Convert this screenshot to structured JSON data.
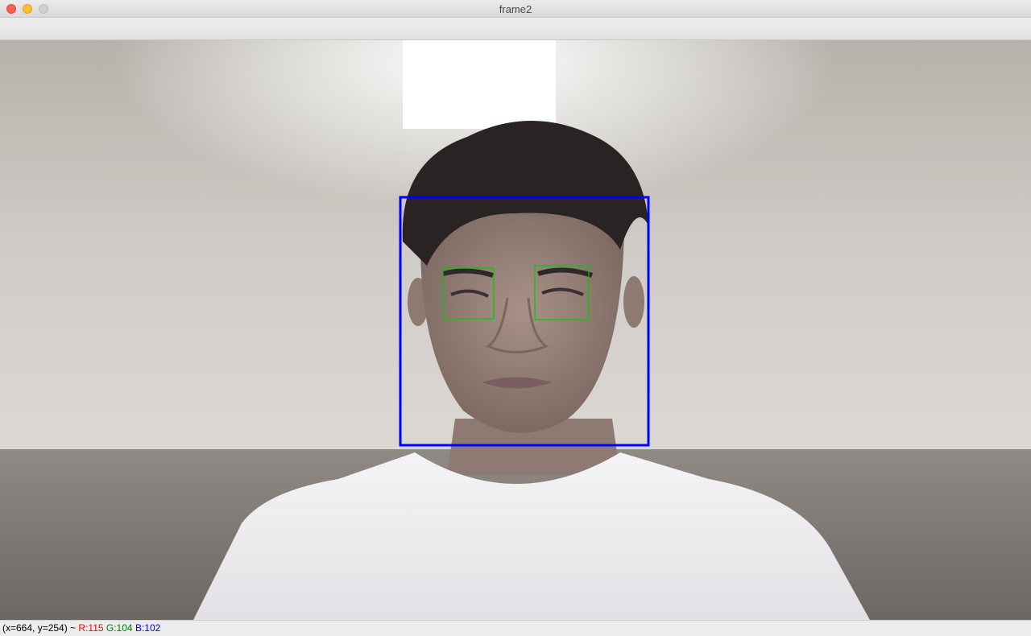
{
  "window": {
    "title": "frame2"
  },
  "frame": {
    "detections": {
      "face_color": "#0000ff",
      "eye_color": "#00cc00"
    }
  },
  "status": {
    "coords": "(x=664, y=254) ~",
    "r_label": "R:115",
    "g_label": "G:104",
    "b_label": "B:102",
    "colors": {
      "r": "#ff0000",
      "g": "#008000",
      "b": "#0000ff"
    }
  }
}
